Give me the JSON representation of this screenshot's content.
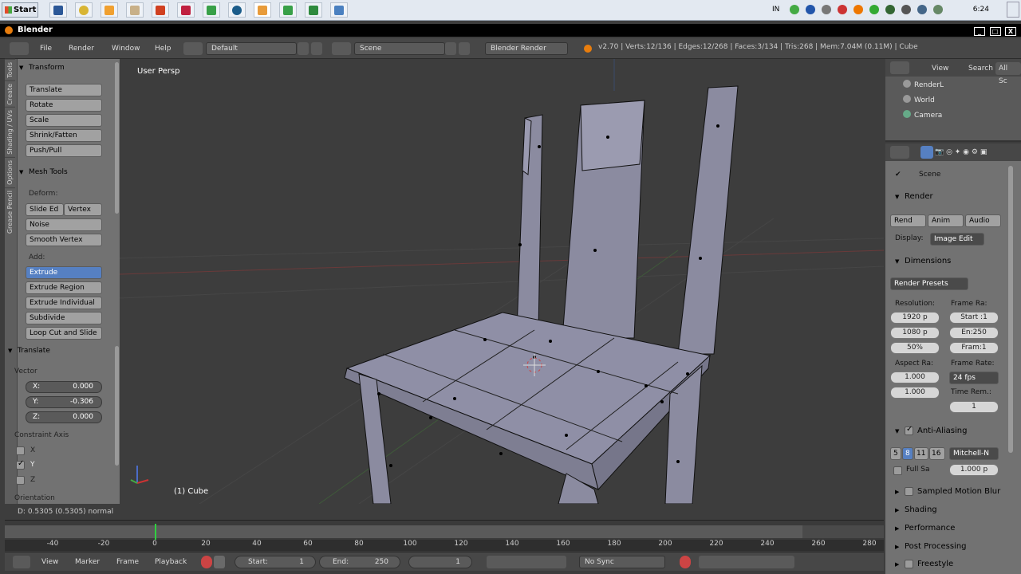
{
  "taskbar": {
    "start_label": "Start",
    "apps": [
      "word",
      "chrome",
      "paint",
      "ppt",
      "blender",
      "photoshop",
      "folder",
      "camtasia",
      "settings",
      "explorer",
      "c-app",
      "image"
    ],
    "tray_lang": "IN",
    "clock": "6:24"
  },
  "window": {
    "title": "Blender",
    "controls": [
      "_",
      "□",
      "X"
    ]
  },
  "infobar": {
    "menus": [
      "File",
      "Render",
      "Window",
      "Help"
    ],
    "layout": "Default",
    "scene": "Scene",
    "engine": "Blender Render",
    "stats": "v2.70 | Verts:12/136 | Edges:12/268 | Faces:3/134 | Tris:268 | Mem:7.04M (0.11M) | Cube"
  },
  "toolshelf": {
    "tabs": [
      "Tools",
      "Create",
      "Shading / UVs",
      "Options",
      "Grease Pencil"
    ],
    "transform_header": "Transform",
    "transform_buttons": [
      "Translate",
      "Rotate",
      "Scale",
      "Shrink/Fatten",
      "Push/Pull"
    ],
    "mesh_tools_header": "Mesh Tools",
    "deform_label": "Deform:",
    "slide_edge": "Slide Ed",
    "vertex": "Vertex",
    "noise": "Noise",
    "smooth_vertex": "Smooth Vertex",
    "add_label": "Add:",
    "add_buttons": [
      "Extrude",
      "Extrude Region",
      "Extrude Individual",
      "Subdivide",
      "Loop Cut and Slide"
    ],
    "translate_header": "Translate",
    "vector_label": "Vector",
    "vector": [
      {
        "l": "X:",
        "v": "0.000"
      },
      {
        "l": "Y:",
        "v": "-0.306"
      },
      {
        "l": "Z:",
        "v": "0.000"
      }
    ],
    "constraint_label": "Constraint Axis",
    "constraints": [
      {
        "l": "X",
        "on": false
      },
      {
        "l": "Y",
        "on": true
      },
      {
        "l": "Z",
        "on": false
      }
    ],
    "orientation_label": "Orientation"
  },
  "viewport": {
    "persp_label": "User Persp",
    "object_label": "(1) Cube",
    "status": "D: 0.5305 (0.5305) normal"
  },
  "timeline": {
    "ticks": [
      "-40",
      "-20",
      "0",
      "20",
      "40",
      "60",
      "80",
      "100",
      "120",
      "140",
      "160",
      "180",
      "200",
      "220",
      "240",
      "260",
      "280"
    ],
    "view": "View",
    "marker": "Marker",
    "frame": "Frame",
    "playback": "Playback",
    "start_label": "Start:",
    "start_value": "1",
    "end_label": "End:",
    "end_value": "250",
    "current": "1",
    "sync": "No Sync"
  },
  "outliner": {
    "view": "View",
    "search": "Search",
    "all_scenes": "All Sc",
    "items": [
      "RenderL",
      "World",
      "Camera"
    ]
  },
  "properties": {
    "scene": "Scene",
    "render_header": "Render",
    "render_btn": "Rend",
    "anim_btn": "Anim",
    "audio_btn": "Audio",
    "display_label": "Display:",
    "display_value": "Image Edit",
    "dimensions_header": "Dimensions",
    "presets": "Render Presets",
    "resolution_label": "Resolution:",
    "res_x": "1920 p",
    "res_y": "1080 p",
    "res_pct": "50%",
    "frame_range_label": "Frame Ra:",
    "frame_start": "Start :1",
    "frame_end": "En:250",
    "frame_step": "Fram:1",
    "aspect_label": "Aspect Ra:",
    "aspect_x": "1.000",
    "aspect_y": "1.000",
    "frame_rate_label": "Frame Rate:",
    "fps": "24 fps",
    "time_remap_label": "Time Rem.:",
    "time_remap": "1",
    "aa_header": "Anti-Aliasing",
    "aa_samples": [
      "5",
      "8",
      "11",
      "16"
    ],
    "aa_filter": "Mitchell-N",
    "full_sample": "Full Sa",
    "filter_size": "1.000 p",
    "sampled_motion_blur": "Sampled Motion Blur",
    "shading": "Shading",
    "performance": "Performance",
    "post_processing": "Post Processing",
    "freestyle": "Freestyle"
  }
}
